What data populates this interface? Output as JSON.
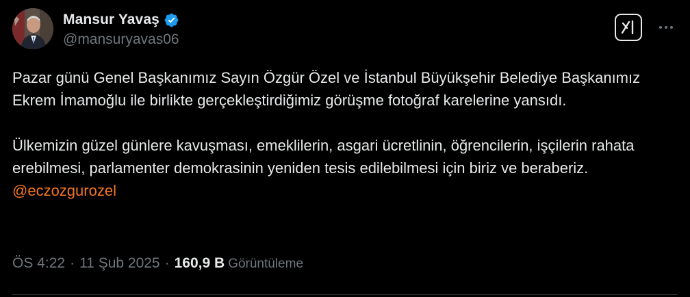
{
  "author": {
    "display_name": "Mansur Yavaş",
    "handle": "@mansuryavas06",
    "verified": true,
    "verified_color": "#1d9bf0",
    "avatar_icon": "profile-photo"
  },
  "actions": {
    "grok_icon": "grok-icon",
    "more_icon": "more-horizontal-icon"
  },
  "tweet": {
    "paragraph1": "Pazar günü Genel Başkanımız Sayın Özgür Özel ve İstanbul Büyükşehir Belediye Başkanımız Ekrem İmamoğlu ile birlikte gerçekleştirdiğimiz görüşme fotoğraf karelerine yansıdı.",
    "paragraph2_text": "Ülkemizin güzel günlere kavuşması, emeklilerin, asgari ücretlinin, öğrencilerin, işçilerin rahata erebilmesi, parlamenter demokrasinin yeniden tesis edilebilmesi için biriz ve beraberiz.",
    "mention": "@eczozgurozel",
    "mention_color": "#f47522"
  },
  "meta": {
    "time": "ÖS 4:22",
    "separator": "·",
    "date": "11 Şub 2025",
    "views_count": "160,9 B",
    "views_label": "Görüntüleme"
  },
  "colors": {
    "background": "#000000",
    "text": "#e7e9ea",
    "secondary": "#71767b"
  }
}
